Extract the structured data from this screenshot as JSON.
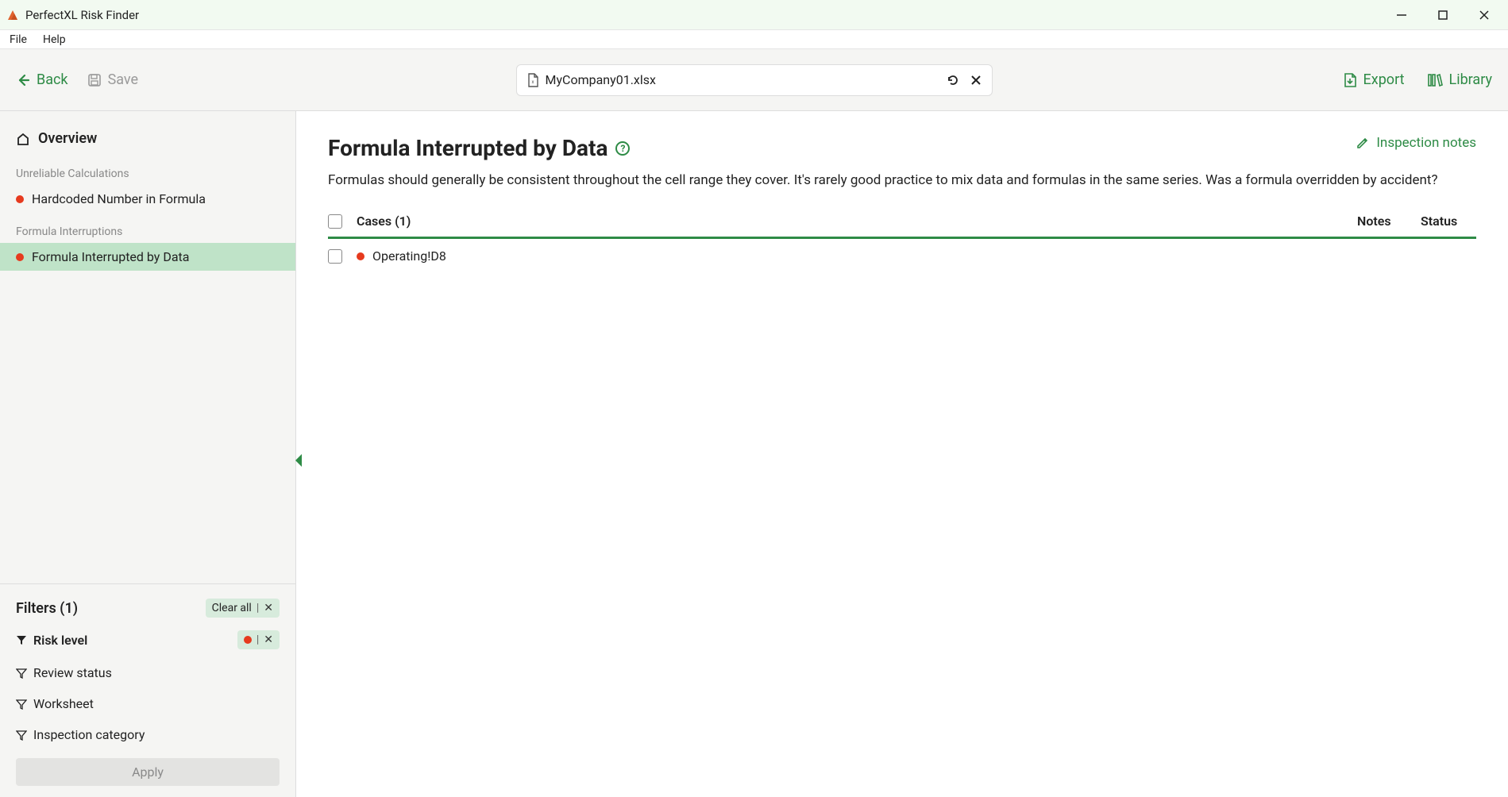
{
  "titlebar": {
    "title": "PerfectXL Risk Finder"
  },
  "menubar": {
    "file": "File",
    "help": "Help"
  },
  "toolbar": {
    "back": "Back",
    "save": "Save",
    "filename": "MyCompany01.xlsx",
    "export": "Export",
    "library": "Library"
  },
  "sidebar": {
    "overview": "Overview",
    "groups": [
      {
        "title": "Unreliable Calculations",
        "items": [
          {
            "label": "Hardcoded Number in Formula",
            "active": false
          }
        ]
      },
      {
        "title": "Formula Interruptions",
        "items": [
          {
            "label": "Formula Interrupted by Data",
            "active": true
          }
        ]
      }
    ]
  },
  "filters": {
    "title": "Filters (1)",
    "clear_all": "Clear all",
    "rows": {
      "risk_level": "Risk level",
      "review_status": "Review status",
      "worksheet": "Worksheet",
      "inspection_category": "Inspection category"
    },
    "apply": "Apply"
  },
  "content": {
    "title": "Formula Interrupted by Data",
    "inspection_notes": "Inspection notes",
    "description": "Formulas should generally be consistent throughout the cell range they cover. It's rarely good practice to mix data and formulas in the same series. Was a formula overridden by accident?",
    "table": {
      "cases_label": "Cases (1)",
      "notes_label": "Notes",
      "status_label": "Status",
      "rows": [
        {
          "name": "Operating!D8"
        }
      ]
    }
  }
}
